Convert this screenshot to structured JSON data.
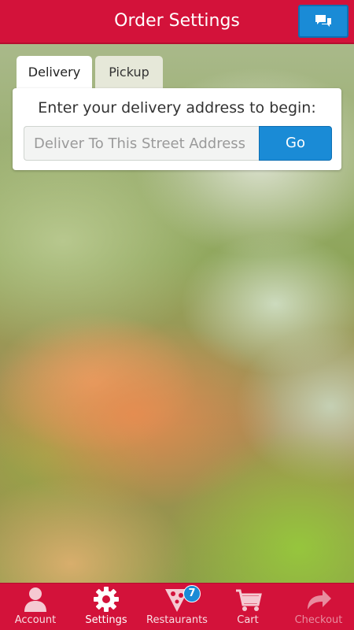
{
  "header": {
    "title": "Order Settings",
    "chat_icon": "chat-icon"
  },
  "tabs": [
    {
      "label": "Delivery",
      "active": true
    },
    {
      "label": "Pickup",
      "active": false
    }
  ],
  "delivery": {
    "prompt": "Enter your delivery address to begin:",
    "address_placeholder": "Deliver To This Street Address",
    "address_value": "",
    "go_label": "Go"
  },
  "nav": {
    "items": [
      {
        "label": "Account",
        "icon": "person-icon"
      },
      {
        "label": "Settings",
        "icon": "gear-icon",
        "active": true
      },
      {
        "label": "Restaurants",
        "icon": "pizza-icon",
        "badge": "7"
      },
      {
        "label": "Cart",
        "icon": "cart-icon"
      },
      {
        "label": "Checkout",
        "icon": "forward-arrow-icon",
        "disabled": true
      }
    ]
  },
  "colors": {
    "brand_red": "#d3123a",
    "accent_blue": "#1a8bd6",
    "tab_inactive": "#e6e8d9"
  }
}
